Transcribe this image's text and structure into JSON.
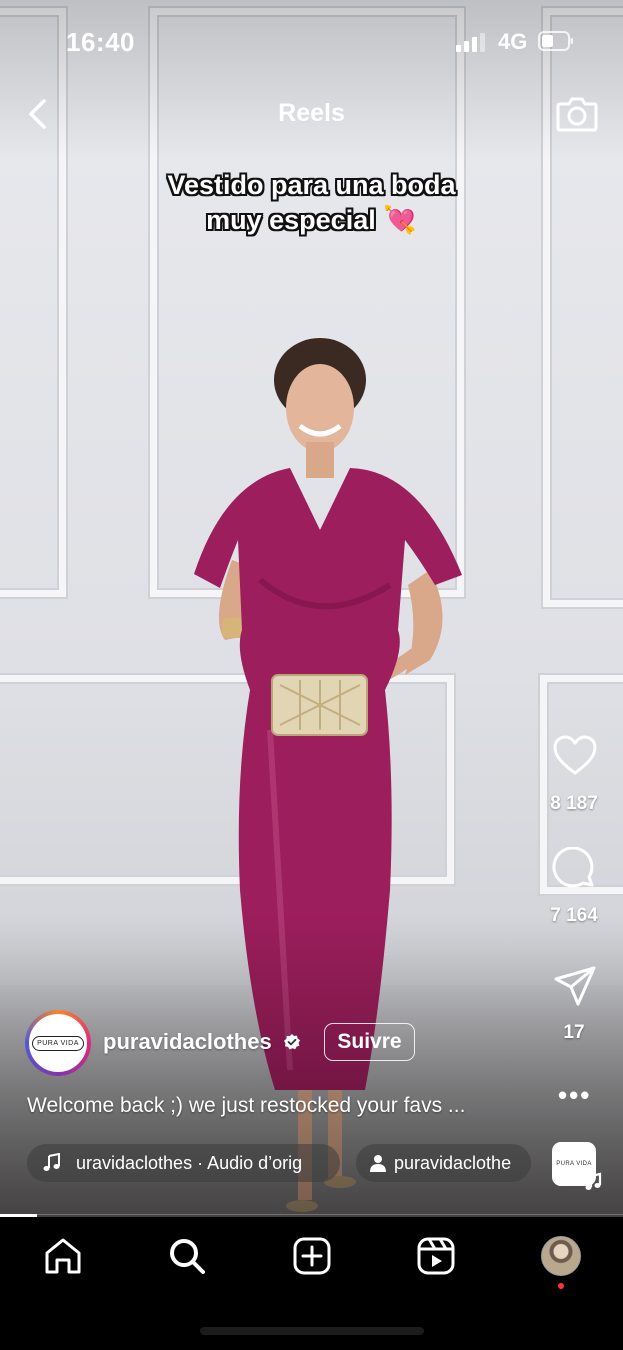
{
  "status_bar": {
    "time": "16:40",
    "network": "4G"
  },
  "header": {
    "title": "Reels"
  },
  "video": {
    "caption_line1": "Vestido para una boda",
    "caption_line2": "muy especial",
    "caption_emoji": "💘",
    "progress": 0.06
  },
  "actions": {
    "likes": "8 187",
    "comments": "7 164",
    "shares": "17",
    "more": "•••"
  },
  "account": {
    "avatar_text": "PURA VIDA",
    "username": "puravidaclothes",
    "follow_label": "Suivre",
    "description": "Welcome back ;) we just restocked your favs ..."
  },
  "audio": {
    "audio_label": "uravidaclothes · Audio d’orig",
    "tagged_label": "puravidaclothe",
    "thumb_text": "PURA VIDA"
  },
  "colors": {
    "accent_red": "#ff3040",
    "dress": "#9c1e5c"
  }
}
